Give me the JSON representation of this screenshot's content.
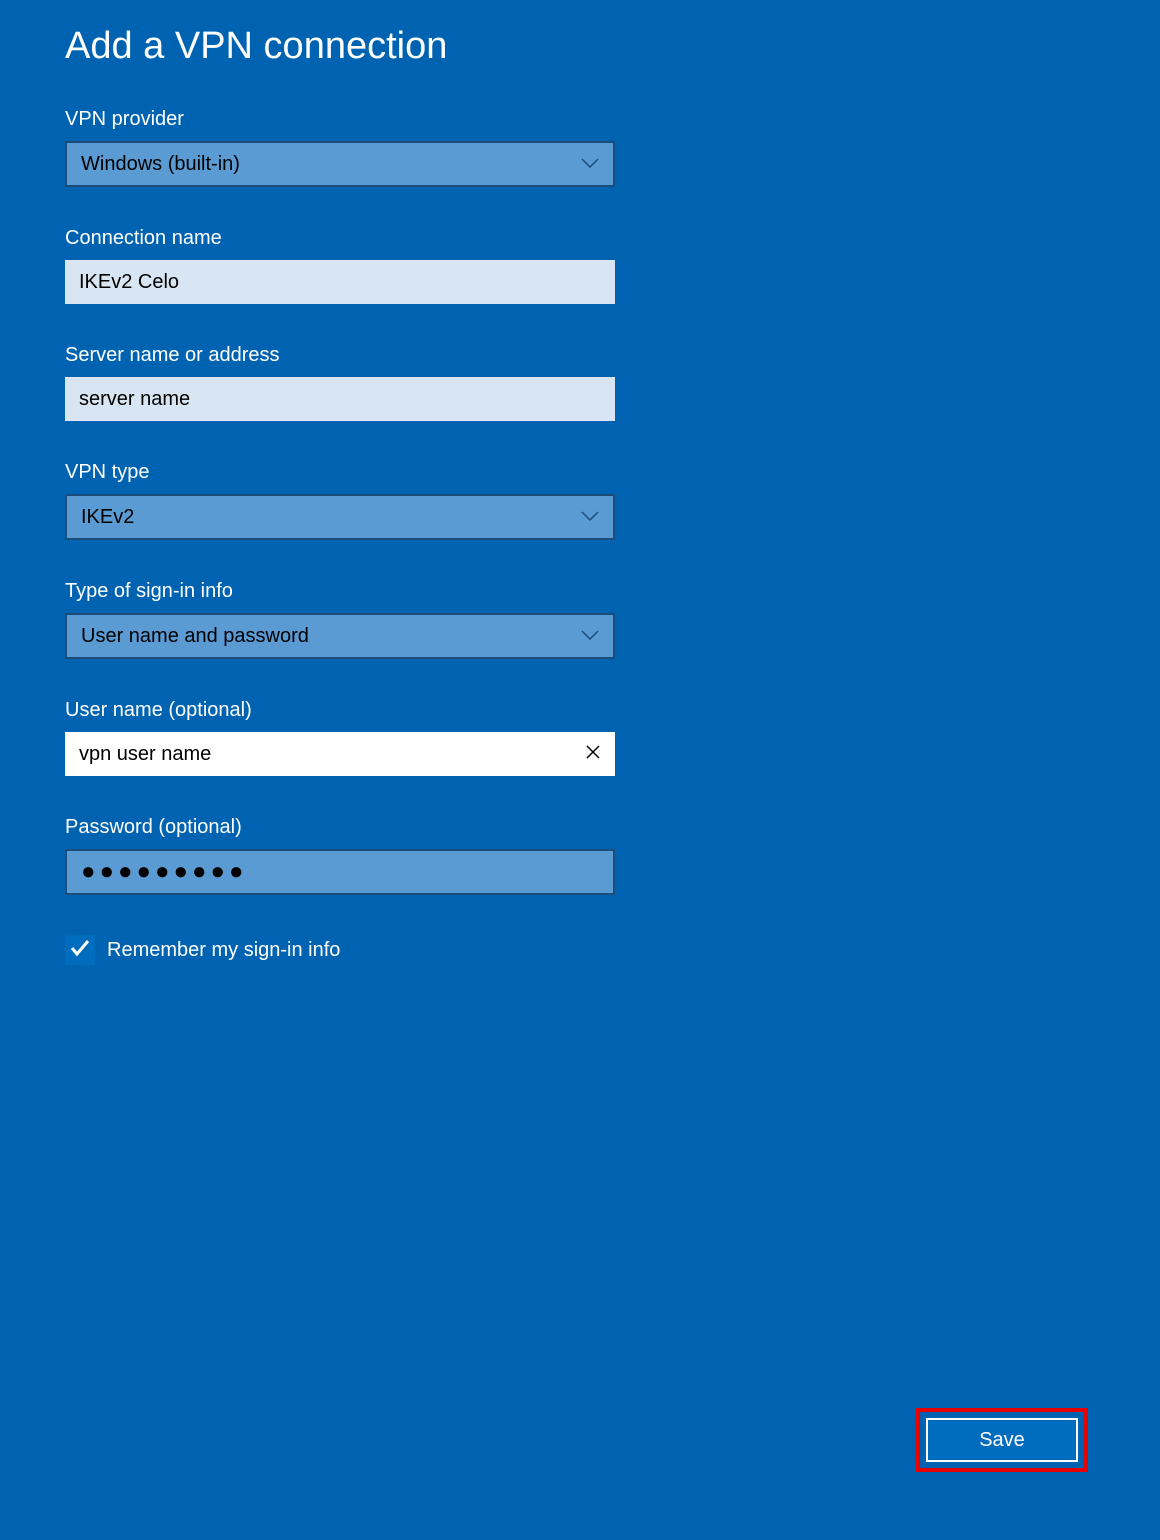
{
  "title": "Add a VPN connection",
  "fields": {
    "vpn_provider": {
      "label": "VPN provider",
      "value": "Windows (built-in)"
    },
    "connection_name": {
      "label": "Connection name",
      "value": "IKEv2 Celo"
    },
    "server_name": {
      "label": "Server name or address",
      "value": "server name"
    },
    "vpn_type": {
      "label": "VPN type",
      "value": "IKEv2"
    },
    "signin_type": {
      "label": "Type of sign-in info",
      "value": "User name and password"
    },
    "username": {
      "label": "User name (optional)",
      "value": "vpn user name"
    },
    "password": {
      "label": "Password (optional)",
      "value": "●●●●●●●●●"
    },
    "remember": {
      "label": "Remember my sign-in info",
      "checked": true
    }
  },
  "buttons": {
    "save": "Save"
  }
}
